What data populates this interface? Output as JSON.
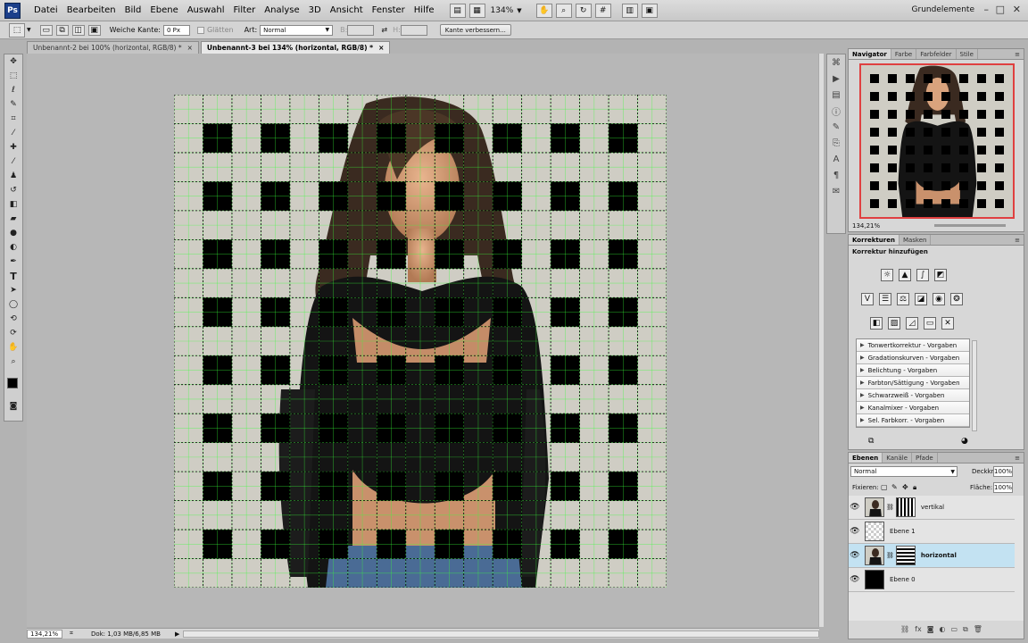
{
  "menubar": {
    "logo": "Ps",
    "items": [
      "Datei",
      "Bearbeiten",
      "Bild",
      "Ebene",
      "Auswahl",
      "Filter",
      "Analyse",
      "3D",
      "Ansicht",
      "Fenster",
      "Hilfe"
    ],
    "zoom": "134%",
    "workspace": "Grundelemente",
    "win_min": "–",
    "win_restore": "□",
    "win_close": "✕"
  },
  "options": {
    "feather_label": "Weiche Kante:",
    "feather_value": "0 Px",
    "smooth_label": "Glätten",
    "style_label": "Art:",
    "style_value": "Normal",
    "w_label": "B:",
    "h_label": "H:",
    "refine_button": "Kante verbessern..."
  },
  "tabs": [
    {
      "label": "Unbenannt-2 bei 100% (horizontal, RGB/8) *",
      "close": "×"
    },
    {
      "label": "Unbenannt-3 bei 134% (horizontal, RGB/8) *",
      "close": "×"
    }
  ],
  "status": {
    "zoom": "134,21%",
    "doc": "Dok: 1,03 MB/6,85 MB"
  },
  "navigator": {
    "tabs": [
      "Navigator",
      "Farbe",
      "Farbfelder",
      "Stile"
    ],
    "zoom": "134,21%"
  },
  "adjustments": {
    "tabs": [
      "Korrekturen",
      "Masken"
    ],
    "title": "Korrektur hinzufügen",
    "presets": [
      "Tonwertkorrektur - Vorgaben",
      "Gradationskurven - Vorgaben",
      "Belichtung - Vorgaben",
      "Farbton/Sättigung - Vorgaben",
      "Schwarzweiß - Vorgaben",
      "Kanalmixer - Vorgaben",
      "Sel. Farbkorr. - Vorgaben"
    ]
  },
  "layers": {
    "tabs": [
      "Ebenen",
      "Kanäle",
      "Pfade"
    ],
    "blend_mode": "Normal",
    "opacity_label": "Deckkraft:",
    "opacity_value": "100%",
    "lock_label": "Fixieren:",
    "fill_label": "Fläche:",
    "fill_value": "100%",
    "items": [
      {
        "name": "vertikal",
        "selected": false
      },
      {
        "name": "Ebene 1",
        "selected": false
      },
      {
        "name": "horizontal",
        "selected": true
      },
      {
        "name": "Ebene 0",
        "selected": false
      }
    ]
  },
  "colors": {
    "selected_layer": "#c3e2f2",
    "grid_line": "#39ff39",
    "navigator_frame": "#e04040",
    "ps_logo": "#1b3f8a"
  }
}
